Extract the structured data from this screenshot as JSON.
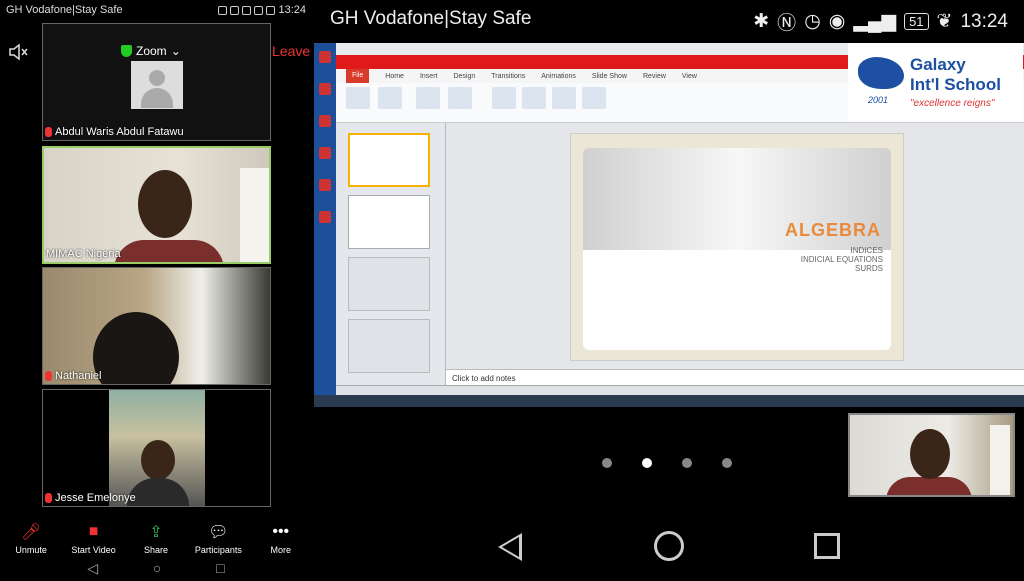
{
  "left_status": {
    "carrier": "GH Vodafone|Stay Safe",
    "time": "13:24"
  },
  "meeting": {
    "app_label": "Zoom",
    "leave_label": "Leave"
  },
  "participants": [
    {
      "name": "Abdul Waris Abdul Fatawu",
      "video": false
    },
    {
      "name": "MIMAC Nigeria",
      "video": true,
      "active": true
    },
    {
      "name": "Nathaniel",
      "video": true
    },
    {
      "name": "Jesse Emelonye",
      "video": true
    }
  ],
  "toolbar": [
    {
      "label": "Unmute",
      "icon": "mic-off-icon",
      "color": "#e33333"
    },
    {
      "label": "Start Video",
      "icon": "video-off-icon",
      "color": "#e33333"
    },
    {
      "label": "Share",
      "icon": "share-icon",
      "color": "#2dbe60"
    },
    {
      "label": "Participants",
      "icon": "participants-icon",
      "color": "#ffffff"
    },
    {
      "label": "More",
      "icon": "more-icon",
      "color": "#ffffff"
    }
  ],
  "right_status": {
    "carrier": "GH Vodafone|Stay Safe",
    "battery": "51",
    "time": "13:24"
  },
  "ppt": {
    "menu_tabs": [
      "File",
      "Home",
      "Insert",
      "Design",
      "Transitions",
      "Animations",
      "Slide Show",
      "Review",
      "View"
    ],
    "slide_title": "ALGEBRA",
    "slide_subtitles": [
      "INDICES",
      "INDICIAL EQUATIONS",
      "SURDS"
    ],
    "notes_placeholder": "Click to add notes"
  },
  "logo": {
    "line1": "Galaxy",
    "line2": "Int'l School",
    "tagline": "\"excellence reigns\"",
    "year": "2001"
  },
  "pager": {
    "count": 4,
    "active_index": 1
  },
  "colors": {
    "leave": "#e33333",
    "active_border": "#99cc66",
    "accent_orange": "#e88b3c",
    "logo_blue": "#1d4fa3"
  }
}
